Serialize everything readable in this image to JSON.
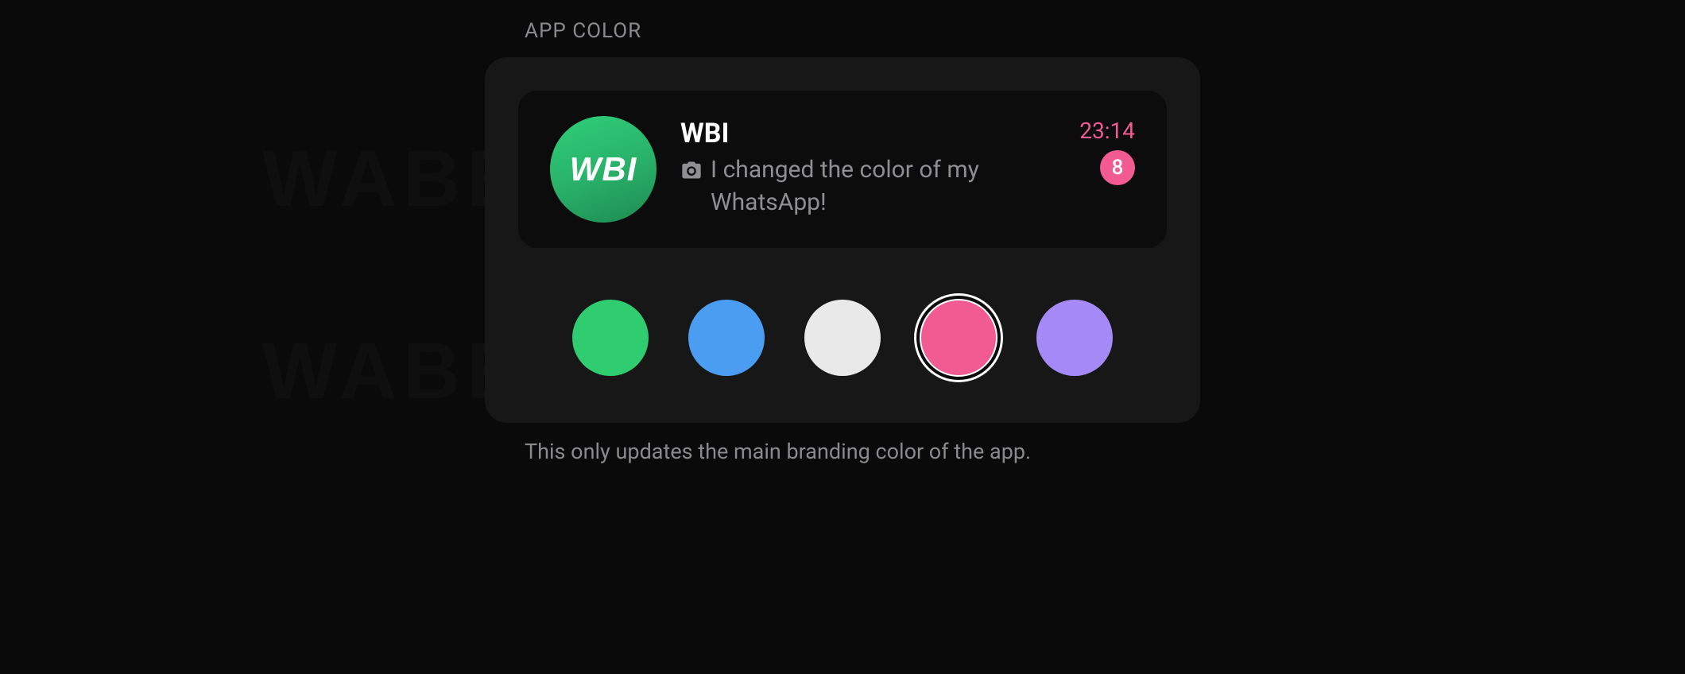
{
  "watermark": "WABETAINFO",
  "section": {
    "header": "APP COLOR",
    "footer": "This only updates the main branding color of the app."
  },
  "chat": {
    "avatar_text": "WBI",
    "title": "WBI",
    "preview": "I changed the color of my WhatsApp!",
    "timestamp": "23:14",
    "unread_count": "8"
  },
  "colors": {
    "accent": "#f25a92",
    "swatches": [
      {
        "name": "green",
        "hex": "#30cc70",
        "selected": false
      },
      {
        "name": "blue",
        "hex": "#4a9df0",
        "selected": false
      },
      {
        "name": "white",
        "hex": "#e9e9e9",
        "selected": false
      },
      {
        "name": "pink",
        "hex": "#f25a92",
        "selected": true
      },
      {
        "name": "purple",
        "hex": "#a58af7",
        "selected": false
      }
    ]
  }
}
